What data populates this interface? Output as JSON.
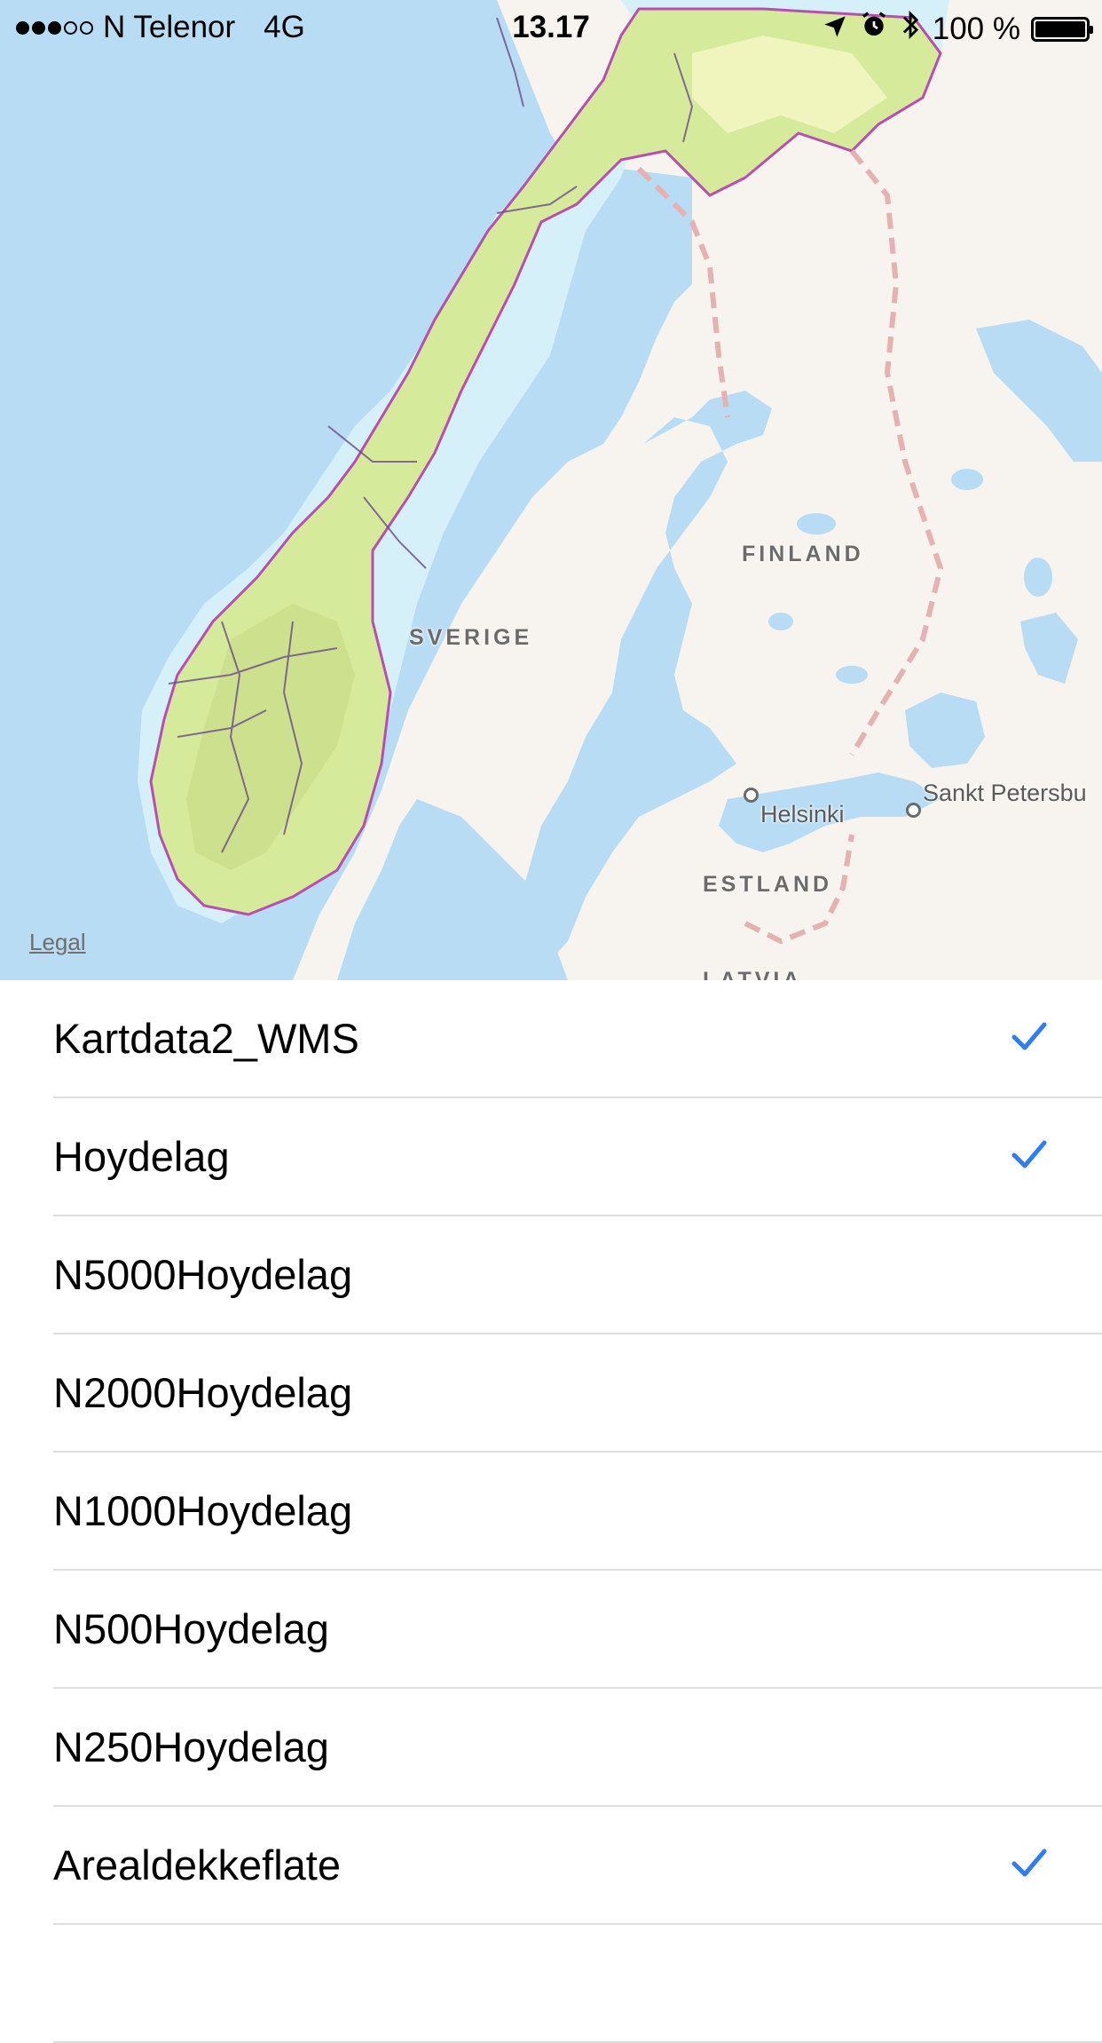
{
  "status_bar": {
    "carrier": "N Telenor",
    "network": "4G",
    "time": "13.17",
    "battery_text": "100 %",
    "signal_bars_filled": 3,
    "signal_bars_total": 5,
    "icons": [
      "location-arrow-icon",
      "alarm-icon",
      "bluetooth-icon",
      "battery-icon"
    ]
  },
  "map": {
    "labels": {
      "sverige": "SVERIGE",
      "finland": "FINLAND",
      "estland": "ESTLAND",
      "latvia": "LATVIA",
      "helsinki": "Helsinki",
      "sankt_petersburg": "Sankt Petersbu"
    },
    "legal_link": "Legal",
    "colors": {
      "water": "#b7dcf3",
      "land": "#f7f3ee",
      "norway_overlay": "#d6ea9c",
      "border": "#e9bcbc"
    }
  },
  "layers": [
    {
      "label": "Kartdata2_WMS",
      "checked": true
    },
    {
      "label": "Hoydelag",
      "checked": true
    },
    {
      "label": "N5000Hoydelag",
      "checked": false
    },
    {
      "label": "N2000Hoydelag",
      "checked": false
    },
    {
      "label": "N1000Hoydelag",
      "checked": false
    },
    {
      "label": "N500Hoydelag",
      "checked": false
    },
    {
      "label": "N250Hoydelag",
      "checked": false
    },
    {
      "label": "Arealdekkeflate",
      "checked": true
    },
    {
      "label": "",
      "checked": false
    }
  ],
  "accent_color": "#2f7cf6"
}
